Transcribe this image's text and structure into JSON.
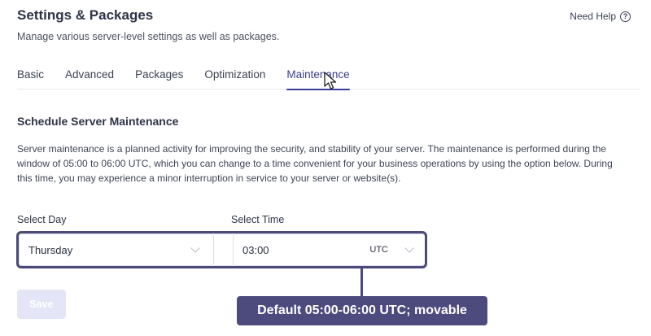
{
  "header": {
    "title": "Settings & Packages",
    "subtitle": "Manage various server-level settings as well as packages.",
    "help_label": "Need Help",
    "help_icon": "question-circle-icon"
  },
  "tabs": [
    {
      "label": "Basic"
    },
    {
      "label": "Advanced"
    },
    {
      "label": "Packages"
    },
    {
      "label": "Optimization"
    },
    {
      "label": "Maintenance",
      "active": true
    }
  ],
  "section": {
    "title": "Schedule Server Maintenance",
    "description": "Server maintenance is a planned activity for improving the security, and stability of your server. The maintenance is performed during the window of 05:00 to 06:00 UTC, which you can change to a time convenient for your business operations by using the option below. During this time, you may experience a minor interruption in service to your server or website(s)."
  },
  "form": {
    "day_label": "Select Day",
    "day_value": "Thursday",
    "time_label": "Select Time",
    "time_value": "03:00",
    "timezone": "UTC",
    "save_label": "Save"
  },
  "annotation": {
    "text": "Default 05:00-06:00 UTC; movable"
  },
  "colors": {
    "accent": "#3b3e9c",
    "annotation": "#4d4a7d",
    "save_disabled": "#e4e5f7"
  }
}
